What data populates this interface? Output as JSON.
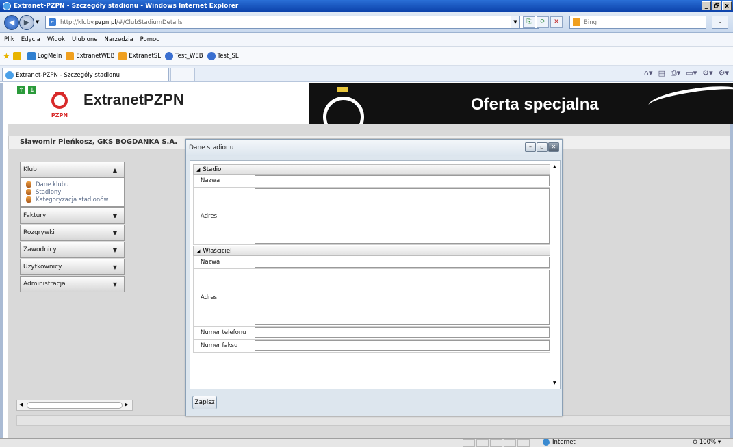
{
  "window": {
    "title": "Extranet-PZPN - Szczegóły stadionu - Windows Internet Explorer",
    "controls": [
      "_",
      "🗗",
      "x"
    ]
  },
  "address_bar": {
    "url_prefix": "http://kluby.",
    "url_domain": "pzpn.pl",
    "url_suffix": "/#/ClubStadiumDetails",
    "search_placeholder": "Bing"
  },
  "menu": [
    "Plik",
    "Edycja",
    "Widok",
    "Ulubione",
    "Narzędzia",
    "Pomoc"
  ],
  "favorites": [
    {
      "label": "",
      "icon": "add-favorites-icon",
      "color": "#e8b400"
    },
    {
      "label": "LogMeIn",
      "icon": "logmein-icon",
      "color": "#2f7fd0"
    },
    {
      "label": "ExtranetWEB",
      "icon": "ie-page-icon",
      "color": "#f0a020"
    },
    {
      "label": "ExtranetSL",
      "icon": "ie-page-icon",
      "color": "#f0a020"
    },
    {
      "label": "Test_WEB",
      "icon": "help-icon",
      "color": "#3a6fd0"
    },
    {
      "label": "Test_SL",
      "icon": "help-icon",
      "color": "#3a6fd0"
    }
  ],
  "tab": {
    "label": "Extranet-PZPN - Szczegóły stadionu"
  },
  "site": {
    "name": "ExtranetPZPN",
    "logo_caption": "PZPN",
    "banner_text": "Oferta specjalna"
  },
  "user": {
    "display": "Sławomir Pieńkosz, GKS BOGDANKA S.A."
  },
  "sidebar": {
    "sections": [
      {
        "label": "Klub",
        "expanded": true,
        "links": [
          "Dane klubu",
          "Stadiony",
          "Kategoryzacja stadionów"
        ]
      },
      {
        "label": "Faktury",
        "expanded": false
      },
      {
        "label": "Rozgrywki",
        "expanded": false
      },
      {
        "label": "Zawodnicy",
        "expanded": false
      },
      {
        "label": "Użytkownicy",
        "expanded": false
      },
      {
        "label": "Administracja",
        "expanded": false
      }
    ]
  },
  "dialog": {
    "title": "Dane stadionu",
    "section_stadion": "Stadion",
    "section_owner": "Właściciel",
    "fields": {
      "stadion_name_label": "Nazwa",
      "stadion_address_label": "Adres",
      "owner_name_label": "Nazwa",
      "owner_address_label": "Adres",
      "phone_label": "Numer telefonu",
      "fax_label": "Numer faksu"
    },
    "values": {
      "stadion_name": "",
      "stadion_address": "",
      "owner_name": "",
      "owner_address": "",
      "phone": "",
      "fax": ""
    },
    "save_label": "Zapisz"
  },
  "status": {
    "zone": "Internet",
    "zoom": "100%"
  }
}
